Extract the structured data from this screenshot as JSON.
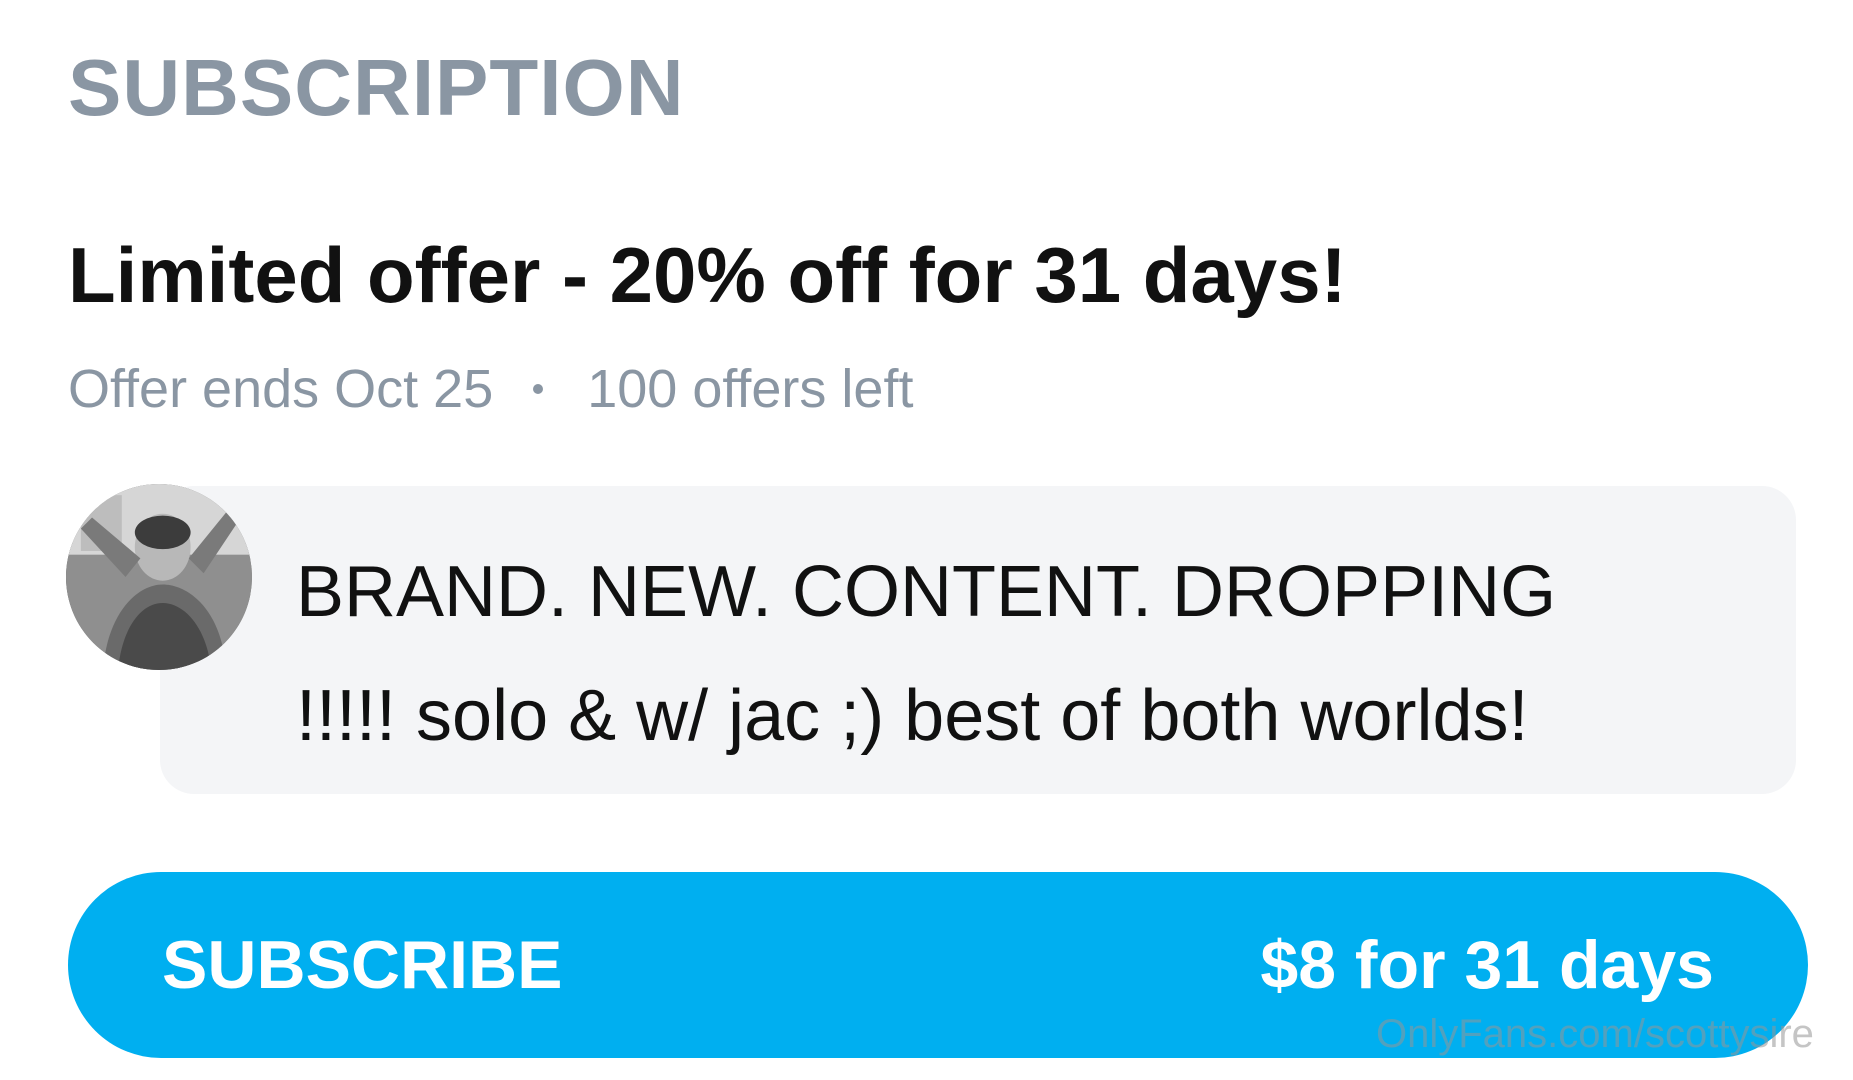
{
  "section": {
    "title": "SUBSCRIPTION"
  },
  "offer": {
    "title": "Limited offer - 20% off for 31 days!",
    "ends": "Offer ends Oct 25",
    "remaining": "100 offers left"
  },
  "message": {
    "avatar_icon": "profile-photo",
    "line1": "BRAND. NEW. CONTENT. DROPPING",
    "line2": "!!!!! solo & w/ jac ;) best of both worlds!"
  },
  "subscribe": {
    "label": "SUBSCRIBE",
    "price": "$8 for 31 days",
    "color": "#00aff0"
  },
  "watermark": "OnlyFans.com/scottysire"
}
